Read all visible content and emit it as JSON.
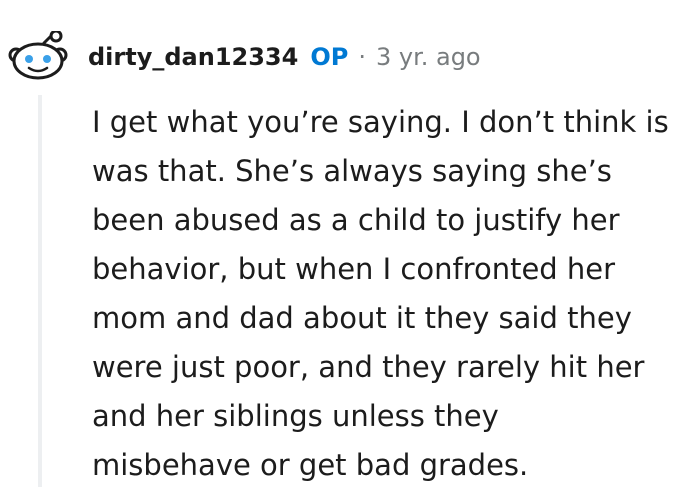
{
  "comment": {
    "author": "dirty_dan12334",
    "badge": "OP",
    "separator": "·",
    "time_ago": "3 yr. ago",
    "avatar_icon": "reddit-snoo-avatar-icon",
    "accent_color": "#0079d3",
    "body_lines": [
      "I get what you’re saying. I don’t think is",
      "was that. She’s always saying she’s",
      "been abused as a child to justify her",
      "behavior, but when I confronted her",
      "mom and dad about it they said they",
      "were just poor, and they rarely hit her",
      "and her siblings unless they",
      "misbehave or get bad grades."
    ]
  }
}
